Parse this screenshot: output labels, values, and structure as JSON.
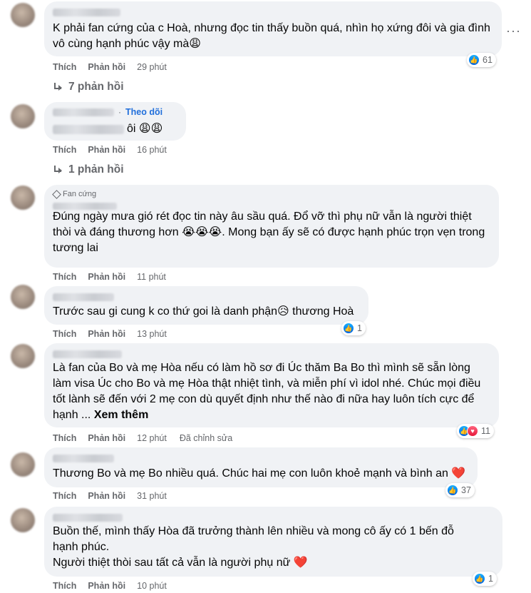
{
  "labels": {
    "like": "Thích",
    "reply": "Phản hồi",
    "follow": "Theo dõi",
    "fan_badge": "Fan cứng",
    "edited": "Đã chỉnh sửa",
    "see_more": "Xem thêm",
    "more_options": "···"
  },
  "comments": [
    {
      "text": "K phải fan cứng của c Hoà, nhưng đọc tin thấy buồn quá, nhìn họ xứng đôi và gia đình vô cùng hạnh phúc vậy mà😩",
      "time": "29 phút",
      "reactions": "61",
      "replies": "7 phản hồi"
    },
    {
      "text": "ôi 😩😩",
      "time": "16 phút",
      "replies": "1 phản hồi"
    },
    {
      "text": "Đúng ngày mưa gió rét đọc tin này âu sầu quá. Đổ vỡ thì phụ nữ vẫn là người thiệt thòi và đáng thương hơn 😭😭😭. Mong bạn ấy sẽ có được hạnh phúc trọn vẹn trong tương lai",
      "time": "11 phút"
    },
    {
      "text": "Trước sau gi cung k co thứ goi là danh phận😥 thương Hoà",
      "time": "13 phút",
      "reactions": "1"
    },
    {
      "text": "Là fan của Bo và mẹ Hòa nếu có làm hồ sơ đi Úc thăm Ba Bo thì mình sẽ sẵn lòng làm visa Úc cho Bo và mẹ Hòa thật nhiệt tình, và miễn phí vì idol nhé. Chúc mọi điều tốt lành sẽ đến với 2 mẹ con dù quyết định như thế nào đi nữa hay luôn tích cực để hạnh ...",
      "time": "12 phút",
      "reactions": "11"
    },
    {
      "text": "Thương Bo và mẹ Bo nhiều quá. Chúc hai mẹ con luôn khoẻ mạnh và bình an ❤️",
      "time": "31 phút",
      "reactions": "37"
    },
    {
      "text_line1": "Buồn thế, mình thấy Hòa đã trưởng thành lên nhiều và mong cô ấy có 1 bến đỗ hạnh phúc.",
      "text_line2": "Người thiệt thòi sau tất cả vẫn là người phụ nữ ❤️",
      "time": "10 phút",
      "reactions": "1"
    }
  ]
}
